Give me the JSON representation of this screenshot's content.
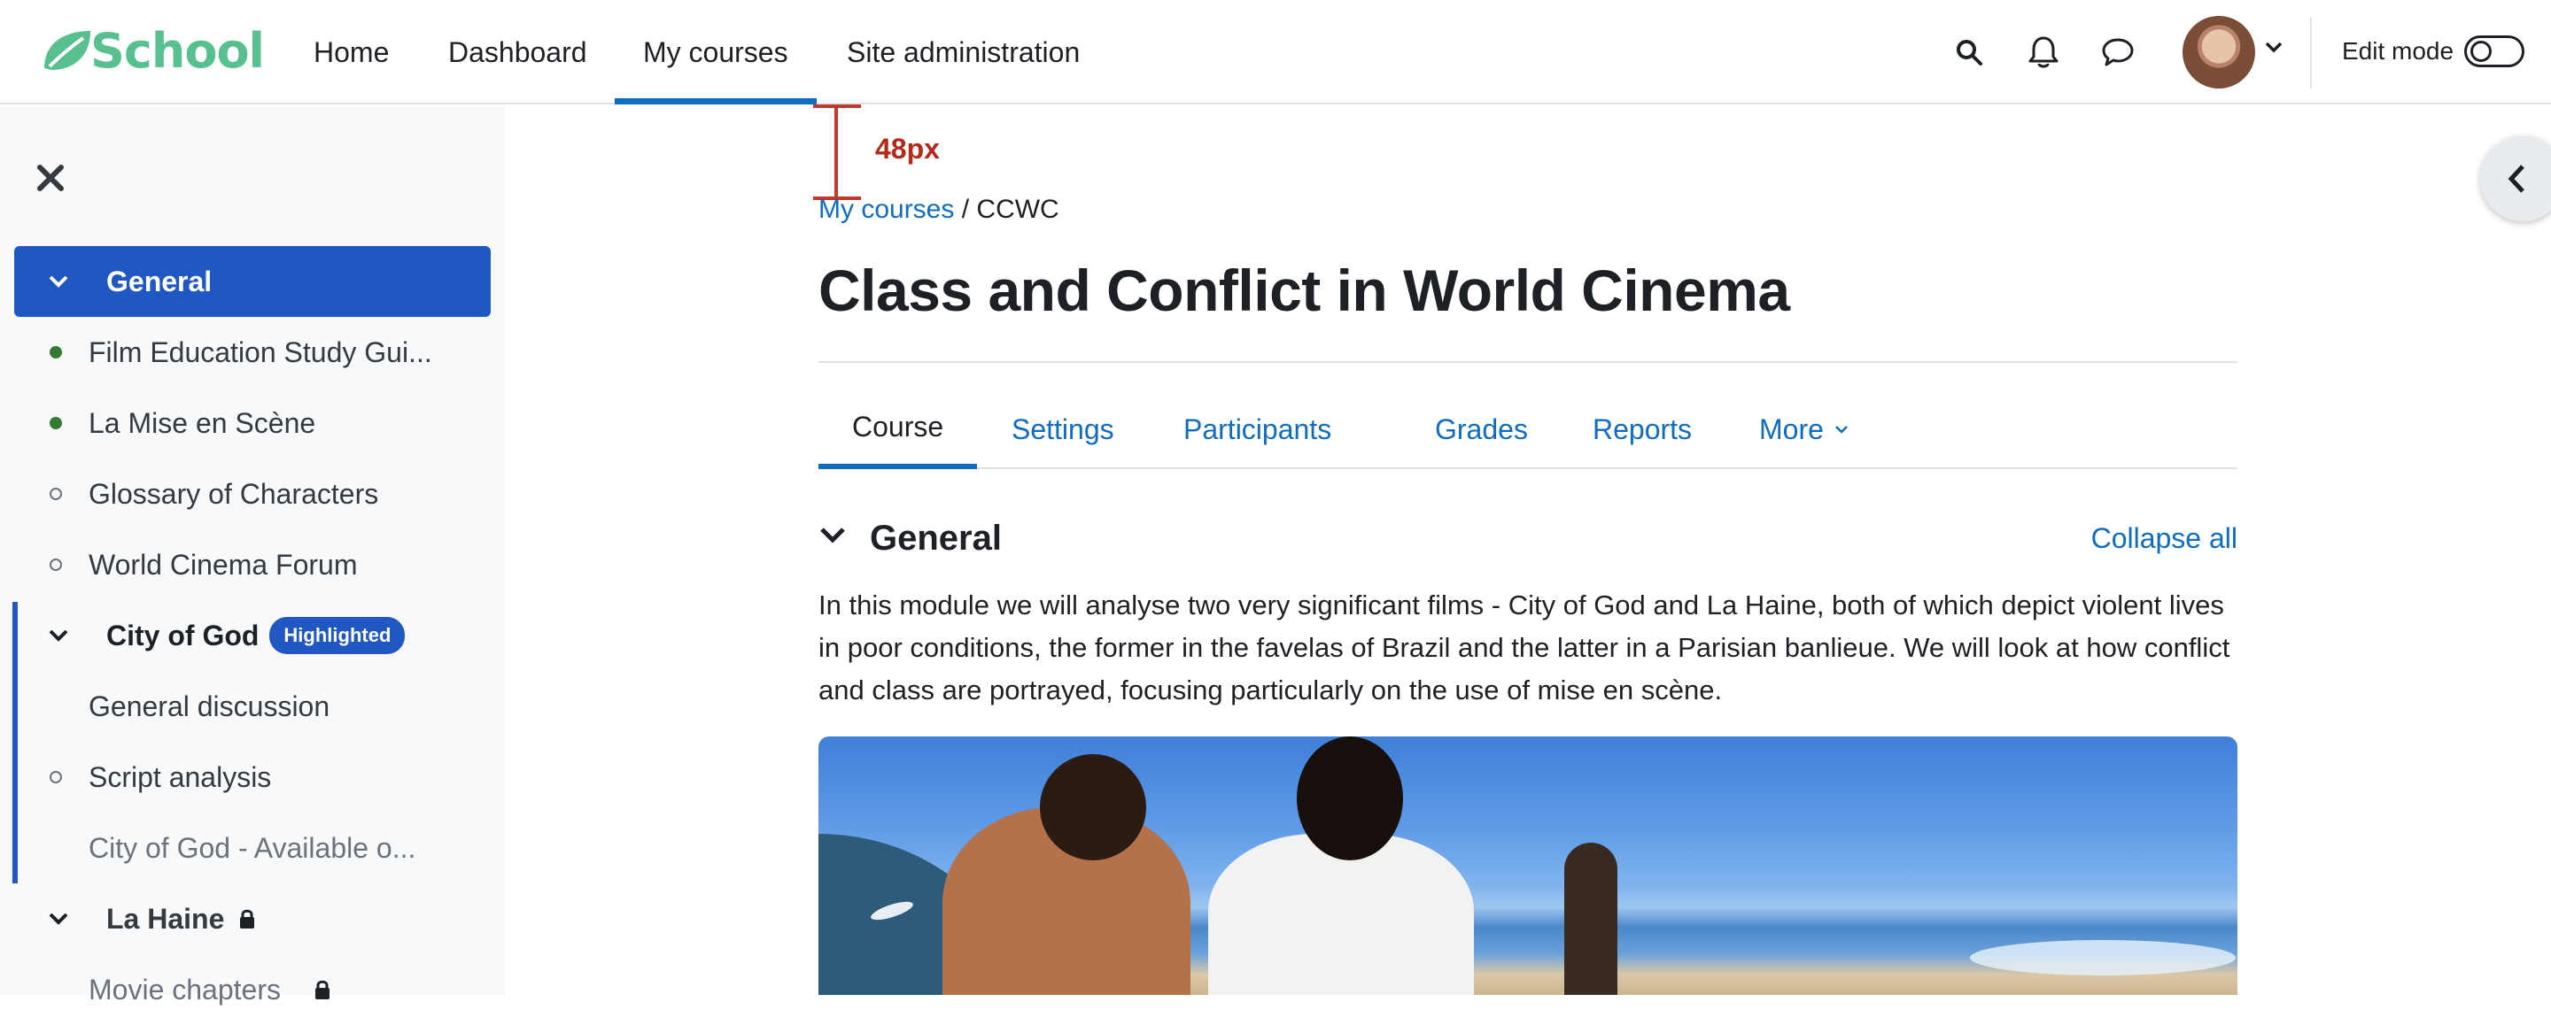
{
  "navbar": {
    "logo_text": "School",
    "links": [
      {
        "label": "Home"
      },
      {
        "label": "Dashboard"
      },
      {
        "label": "My courses"
      },
      {
        "label": "Site administration"
      }
    ],
    "edit_mode_label": "Edit mode",
    "edit_mode_on": false,
    "icons": [
      "search-icon",
      "bell-icon",
      "chat-icon",
      "chevron-down-icon"
    ]
  },
  "annotation": {
    "measure_label": "48px",
    "color": "#c0392b"
  },
  "drawer": {
    "sections": [
      {
        "label": "General",
        "active": true
      },
      {
        "label": "City of God",
        "badge": "Highlighted"
      },
      {
        "label": "La Haine",
        "locked": true
      }
    ],
    "items": [
      {
        "label": "Film Education Study Gui...",
        "status": "done"
      },
      {
        "label": "La Mise en Scène",
        "status": "done"
      },
      {
        "label": "Glossary of Characters",
        "status": "todo"
      },
      {
        "label": "World Cinema Forum",
        "status": "todo"
      },
      {
        "label": "General discussion",
        "status": "none"
      },
      {
        "label": "Script analysis",
        "status": "todo"
      },
      {
        "label": "City of God - Available o...",
        "status": "none"
      },
      {
        "label": "Movie chapters",
        "status": "none"
      }
    ]
  },
  "breadcrumb": {
    "link": "My courses",
    "separator": "/",
    "current": "CCWC"
  },
  "course": {
    "title": "Class and Conflict in World Cinema",
    "tabs": [
      {
        "label": "Course",
        "active": true
      },
      {
        "label": "Settings"
      },
      {
        "label": "Participants"
      },
      {
        "label": "Grades"
      },
      {
        "label": "Reports"
      },
      {
        "label": "More"
      }
    ],
    "section_name": "General",
    "collapse_all": "Collapse all",
    "summary": "In this module we will analyse two very significant films - City of God and La Haine, both of which depict violent lives in poor conditions, the former in the favelas of Brazil and the latter in a Parisian banlieue. We will look at how conflict and class are portrayed, focusing particularly on the use of mise en scène."
  },
  "colors": {
    "brand": "#58c08e",
    "primary": "#0f6cbf",
    "drawer_active": "#1f57c3",
    "completion_done": "#357a32"
  }
}
